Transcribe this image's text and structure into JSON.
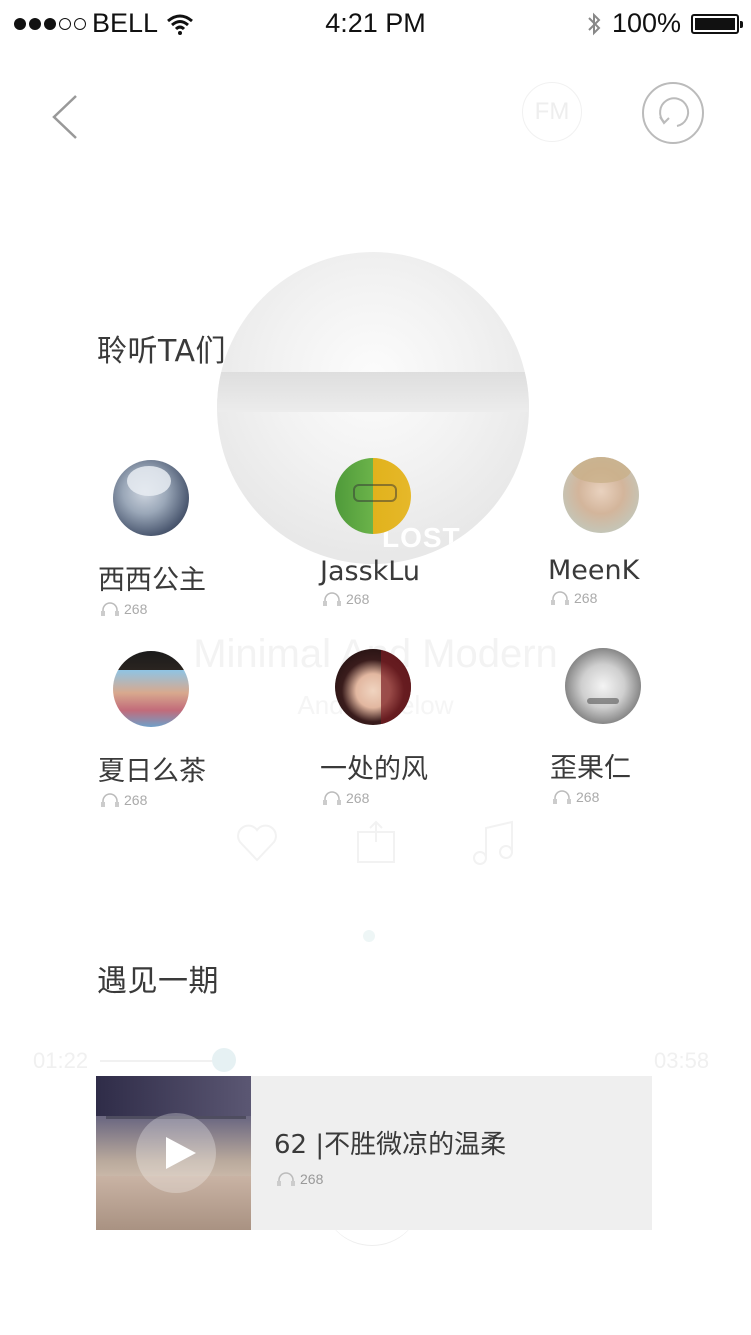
{
  "status_bar": {
    "carrier": "BELL",
    "time": "4:21 PM",
    "battery": "100%"
  },
  "nav": {
    "fm_label": "FM"
  },
  "background_player": {
    "album_text": "LOST",
    "track_title": "Minimal And Modern",
    "artist": "Andi... ...elow",
    "elapsed": "01:22",
    "duration": "03:58"
  },
  "listeners_section": {
    "title": "聆听TA们",
    "users": [
      {
        "name": "西西公主",
        "count": "268"
      },
      {
        "name": "JasskLu",
        "count": "268"
      },
      {
        "name": "MeenK",
        "count": "268"
      },
      {
        "name": "夏日么茶",
        "count": "268"
      },
      {
        "name": "一处的风",
        "count": "268"
      },
      {
        "name": "歪果仁",
        "count": "268"
      }
    ]
  },
  "episode_section": {
    "title": "遇见一期",
    "episode": {
      "title": "62 |不胜微凉的温柔",
      "count": "268"
    }
  },
  "colors": {
    "text": "#3a3a3a",
    "muted": "#aaaaaa",
    "card_bg": "#efefef"
  }
}
